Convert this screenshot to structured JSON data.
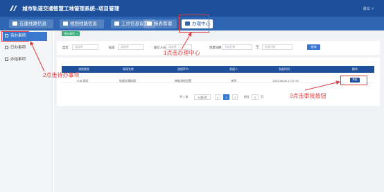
{
  "header": {
    "app_title": "城市轨道交通智慧工地管理系统--项目管理",
    "user_label": "退出 ∨"
  },
  "nav": {
    "tabs": [
      {
        "label": "在建线路信息"
      },
      {
        "label": "规划线路信息"
      },
      {
        "label": "工点信息设置"
      },
      {
        "label": "报表管理"
      },
      {
        "label": "办理中心"
      }
    ],
    "active_tab": "办理中心"
  },
  "sidebar": {
    "items": [
      {
        "label": "待办事项"
      },
      {
        "label": "已办事项"
      },
      {
        "label": "办结事项"
      }
    ],
    "active_item": "待办事项"
  },
  "breadcrumb_chip": {
    "label": "待办事项",
    "close": "×"
  },
  "filters": {
    "type_label": "类型",
    "type_placeholder": "请选择",
    "item_label": "标段",
    "item_placeholder": "请选择",
    "submitter_label": "提交人员",
    "submitter_placeholder": "请选择",
    "date_label": "创建日期",
    "date_start_placeholder": "开始日期",
    "date_sep": "至",
    "date_end_placeholder": "结束日期",
    "query_button": "查询"
  },
  "table": {
    "columns": [
      "流程类型",
      "标段名称",
      "流程环节",
      "发起人",
      "发起时间",
      "操作"
    ],
    "rows": [
      {
        "type": "TU8-测试",
        "section": "轨道交通标段",
        "step": "审批流程设置",
        "initiator": "李四",
        "time": "2023-09-08 17:37:19",
        "action": "审批"
      }
    ]
  },
  "pagination": {
    "total": "共 1 条",
    "page_size": "10条/页",
    "prev": "<",
    "current_page": "1",
    "next": ">",
    "goto_label": "前往",
    "goto_value": "1",
    "page_suffix": "页"
  },
  "annotations": {
    "step1": "1点击办理中心",
    "step2": "2点击待办事项",
    "step3": "3点击审批按钮",
    "color": "#e23b3b"
  },
  "colors": {
    "header_bg": "#1d4f9a",
    "nav_bg": "#2f66b3",
    "accent": "#3a78d0",
    "chip_green": "#3aae7c"
  }
}
